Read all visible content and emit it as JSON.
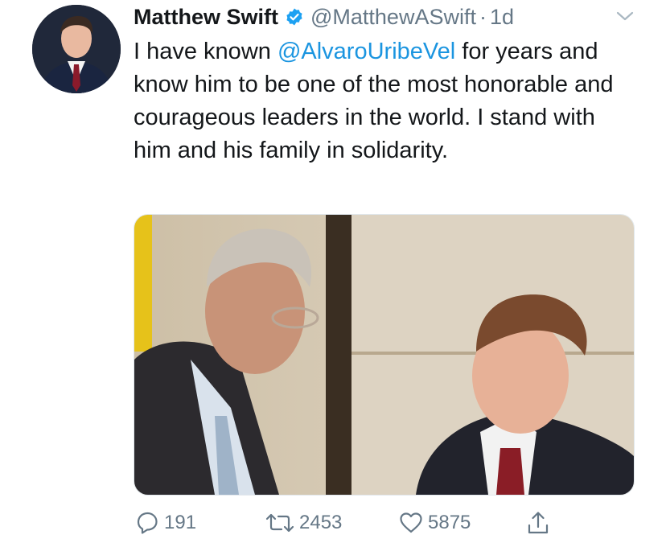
{
  "tweet": {
    "author_name": "Matthew Swift",
    "handle": "@MatthewASwift",
    "dot": "·",
    "time": "1d",
    "text_before": "I have known ",
    "mention": "@AlvaroUribeVel",
    "text_after": " for years and know him to be one of the most honorable and courageous leaders in the world. I stand with him and his family in solidarity."
  },
  "actions": {
    "replies": "191",
    "retweets": "2453",
    "likes": "5875"
  },
  "icons": {
    "verified": "verified-badge-icon",
    "more": "chevron-down-icon",
    "reply": "reply-icon",
    "retweet": "retweet-icon",
    "like": "heart-icon",
    "share": "share-icon"
  },
  "colors": {
    "verified": "#1da1f2",
    "mention": "#1b95e0",
    "secondary": "#657786"
  }
}
